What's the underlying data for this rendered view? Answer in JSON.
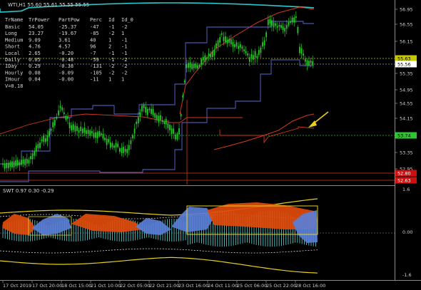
{
  "main_header": "WTI,H1  55.60 55.61 55.55 55.55",
  "sub_header": "SWT 0.97 0.30 -0.29",
  "info_table": {
    "columns": [
      "TrName",
      "TrPower",
      "PartPow",
      "Perc",
      "Id",
      "Id_0"
    ],
    "rows": [
      [
        "Basic",
        "54.05",
        "-25.37",
        "-47",
        "-1",
        "-2"
      ],
      [
        "Long",
        "23.27",
        "-19.67",
        "-85",
        "-2",
        "1"
      ],
      [
        "Medium",
        "9.09",
        "3.61",
        "40",
        "1",
        "-1"
      ],
      [
        "Short",
        "4.76",
        "4.57",
        "96",
        "2",
        "-1"
      ],
      [
        "Local",
        "2.65",
        "-0.20",
        "-7",
        "-1",
        "-1"
      ],
      [
        "Daily",
        "0.05",
        "-0.48",
        "-59",
        "-1",
        "-2"
      ],
      [
        "IDay",
        "0.29",
        "-0.38",
        "-131",
        "-2",
        "-2"
      ],
      [
        "Hourly",
        "0.08",
        "-0.09",
        "-105",
        "-2",
        "-2"
      ],
      [
        "IHour",
        "0.04",
        "-0.00",
        "-11",
        "1",
        "1"
      ]
    ],
    "footer": "V=0.18"
  },
  "price_axis": [
    "56.95",
    "56.55",
    "56.15",
    "55.75",
    "55.35",
    "54.95",
    "54.55",
    "54.15",
    "53.35",
    "52.95"
  ],
  "price_tags": [
    {
      "label": "55.63",
      "color": "#c8c800",
      "text": "#000000"
    },
    {
      "label": "55.56",
      "color": "#ffffff",
      "text": "#000000"
    },
    {
      "label": "53.74",
      "color": "#2ec62e",
      "text": "#000000"
    },
    {
      "label": "52.80",
      "color": "#d01010",
      "text": "#ffffff"
    },
    {
      "label": "52.63",
      "color": "#d01010",
      "text": "#ffffff"
    }
  ],
  "osc_axis": [
    "1.6",
    "0.00",
    "-1.6"
  ],
  "time_axis": [
    "17 Oct 2019",
    "17 Oct 20:00",
    "18 Oct 15:00",
    "21 Oct 10:00",
    "22 Oct 05:00",
    "22 Oct 21:00",
    "23 Oct 16:00",
    "24 Oct 11:00",
    "25 Oct 06:00",
    "25 Oct 22:00",
    "28 Oct 16:00"
  ],
  "colors": {
    "background": "#000000",
    "bull": "#22cc22",
    "upper_band": "#2ec8c8",
    "channel": "#5a6cd8",
    "ma": "#d43a18",
    "arrow": "#e8d020"
  }
}
